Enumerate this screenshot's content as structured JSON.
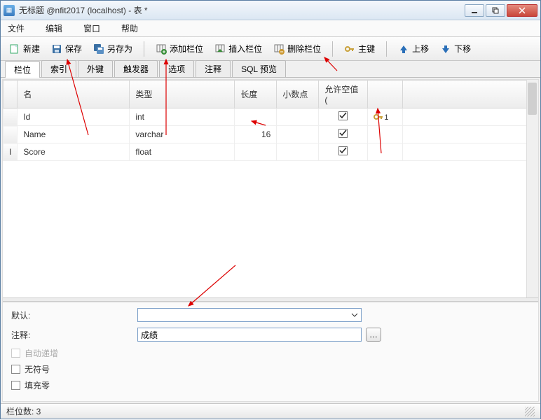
{
  "window": {
    "title": "无标题 @nfit2017 (localhost) - 表 *"
  },
  "menu": {
    "file": "文件",
    "edit": "编辑",
    "window": "窗口",
    "help": "帮助"
  },
  "toolbar": {
    "new": "新建",
    "save": "保存",
    "saveas": "另存为",
    "addcol": "添加栏位",
    "insertcol": "插入栏位",
    "deletecol": "删除栏位",
    "primarykey": "主键",
    "moveup": "上移",
    "movedown": "下移"
  },
  "tabs": {
    "fields": "栏位",
    "indexes": "索引",
    "foreignkeys": "外键",
    "triggers": "触发器",
    "options": "选项",
    "comment": "注释",
    "sqlpreview": "SQL 预览"
  },
  "grid": {
    "headers": {
      "name": "名",
      "type": "类型",
      "length": "长度",
      "decimals": "小数点",
      "allownull": "允许空值 (",
      "key": ""
    },
    "rows": [
      {
        "name": "Id",
        "type": "int",
        "length": "",
        "decimals": "",
        "allownull": true,
        "pk": true
      },
      {
        "name": "Name",
        "type": "varchar",
        "length": "16",
        "decimals": "",
        "allownull": true,
        "pk": false
      },
      {
        "name": "Score",
        "type": "float",
        "length": "",
        "decimals": "",
        "allownull": true,
        "pk": false
      }
    ],
    "editing_row_marker": "I"
  },
  "props": {
    "default_label": "默认:",
    "default_value": "",
    "comment_label": "注释:",
    "comment_value": "成绩",
    "autoinc": "自动递增",
    "unsigned": "无符号",
    "zerofill": "填充零"
  },
  "status": {
    "fieldcount_label": "栏位数: ",
    "fieldcount": "3"
  }
}
